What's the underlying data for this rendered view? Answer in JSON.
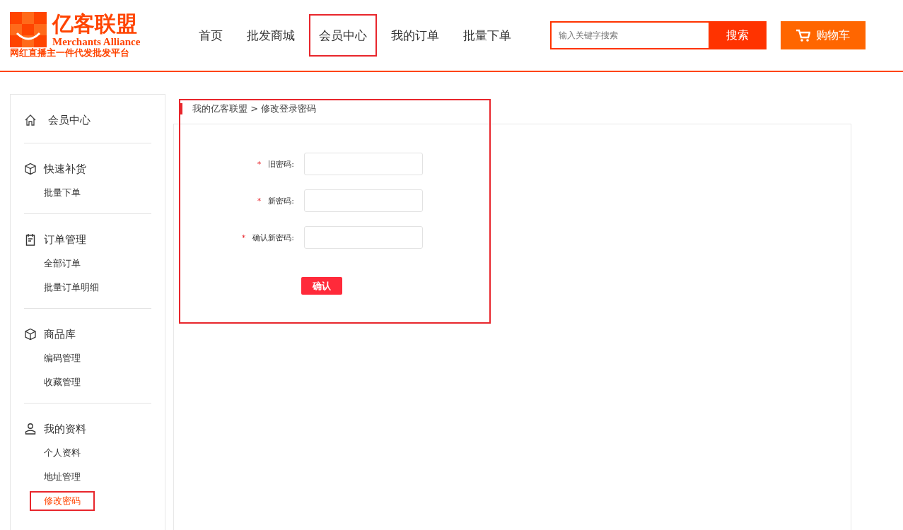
{
  "logo": {
    "title": "亿客联盟",
    "subtitle": "Merchants Alliance",
    "slogan": "网红直播主一件代发批发平台"
  },
  "nav": [
    {
      "label": "首页",
      "selected": false
    },
    {
      "label": "批发商城",
      "selected": false
    },
    {
      "label": "会员中心",
      "selected": true
    },
    {
      "label": "我的订单",
      "selected": false
    },
    {
      "label": "批量下单",
      "selected": false
    }
  ],
  "search": {
    "placeholder": "输入关键字搜索",
    "button": "搜索"
  },
  "cart": {
    "label": "购物车"
  },
  "sidebar": [
    {
      "kind": "home",
      "title": "会员中心"
    },
    {
      "kind": "box",
      "title": "快速补货",
      "items": [
        {
          "label": "批量下单",
          "selected": false
        }
      ]
    },
    {
      "kind": "clipboard",
      "title": "订单管理",
      "items": [
        {
          "label": "全部订单",
          "selected": false
        },
        {
          "label": "批量订单明细",
          "selected": false
        }
      ]
    },
    {
      "kind": "box",
      "title": "商品库",
      "items": [
        {
          "label": "编码管理",
          "selected": false
        },
        {
          "label": "收藏管理",
          "selected": false
        }
      ]
    },
    {
      "kind": "user",
      "title": "我的资料",
      "items": [
        {
          "label": "个人资料",
          "selected": false
        },
        {
          "label": "地址管理",
          "selected": false
        },
        {
          "label": "修改密码",
          "selected": true
        }
      ]
    }
  ],
  "breadcrumb": {
    "parts": [
      "我的亿客联盟",
      "修改登录密码"
    ],
    "separator": ">"
  },
  "form": {
    "highlighted": true,
    "fields": [
      {
        "label": "旧密码:",
        "required_mark": "*"
      },
      {
        "label": "新密码:",
        "required_mark": "*"
      },
      {
        "label": "确认新密码:",
        "required_mark": "*"
      }
    ],
    "submit": "确认"
  }
}
